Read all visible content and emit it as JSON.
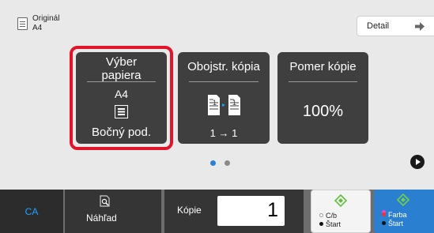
{
  "original": {
    "label": "Originál",
    "size": "A4"
  },
  "detail_button": {
    "label": "Detail"
  },
  "tiles": {
    "paper": {
      "title_line1": "Výber",
      "title_line2": "papiera",
      "size": "A4",
      "tray": "Bočný pod."
    },
    "duplex": {
      "title": "Obojstr. kópia",
      "mode": "1 → 1"
    },
    "ratio": {
      "title": "Pomer kópie",
      "value": "100%"
    }
  },
  "pager": {
    "active_color": "#2b80d6",
    "inactive_color": "#8a8a8a",
    "pages": 2,
    "current": 1
  },
  "bottom": {
    "ca_label": "CA",
    "preview_label": "Náhľad",
    "copies_label": "Kópie",
    "copies_value": "1",
    "start_bw": {
      "line1": "C/b",
      "line2": "Štart"
    },
    "start_color": {
      "line1": "Farba",
      "line2": "Štart"
    }
  },
  "colors": {
    "highlight": "#e0142b",
    "accent_blue": "#1ea3ff",
    "start_green": "#5fbf3a",
    "color_start_bg": "#2b7fd1"
  },
  "icons": [
    "document-icon",
    "arrow-right-icon",
    "paper-tray-icon",
    "duplex-pages-icon",
    "next-page-icon",
    "preview-icon",
    "start-diamond-icon"
  ]
}
